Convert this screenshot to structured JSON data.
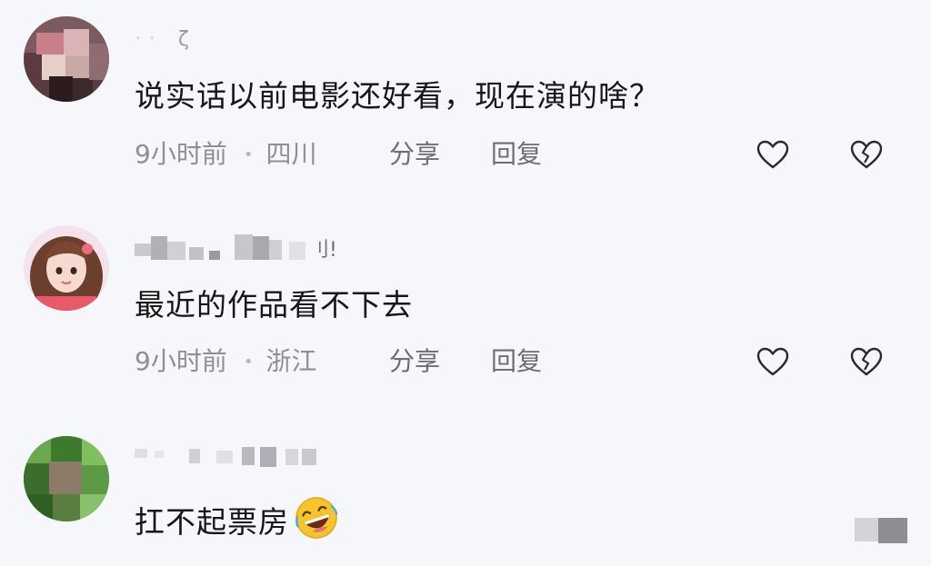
{
  "comments": [
    {
      "text": "说实话以前电影还好看，现在演的啥？",
      "time": "9小时前",
      "location": "四川",
      "share_label": "分享",
      "reply_label": "回复"
    },
    {
      "username_tail": "刂!",
      "text": "最近的作品看不下去",
      "time": "9小时前",
      "location": "浙江",
      "share_label": "分享",
      "reply_label": "回复"
    },
    {
      "text": "扛不起票房",
      "emoji": "laughing-crying-emoji",
      "time": "",
      "location": "",
      "share_label": "",
      "reply_label": ""
    }
  ],
  "icons": {
    "like": "heart-outline-icon",
    "dislike": "broken-heart-icon"
  },
  "colors": {
    "background": "#f6f7fb",
    "text": "#171717",
    "meta": "#8f8f96",
    "emoji": "#f7c52b"
  }
}
